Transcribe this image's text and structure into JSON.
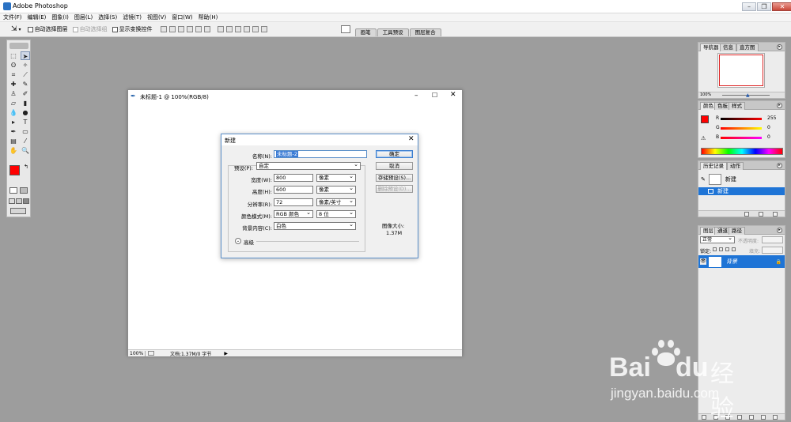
{
  "app": {
    "title": "Adobe Photoshop"
  },
  "window_controls": {
    "minimize": "–",
    "restore": "❐",
    "close": "✕"
  },
  "menu": [
    "文件(F)",
    "编辑(E)",
    "图象(I)",
    "图层(L)",
    "选择(S)",
    "滤镜(T)",
    "视图(V)",
    "窗口(W)",
    "帮助(H)"
  ],
  "options_bar": {
    "auto_select_layer": "自动选择图层",
    "auto_select_group": "自动选择组",
    "show_transform": "显示变换控件",
    "dock_tabs": [
      "画笔",
      "工具预设",
      "图层复合"
    ]
  },
  "document": {
    "title": "未标题-1 @ 100%(RGB/8)",
    "zoom": "100%",
    "doc_info": "文档:1.37M/0 字节"
  },
  "new_dialog": {
    "title": "新建",
    "name_label": "名称(N):",
    "name_value": "未标题-2",
    "preset_label": "预设(P):",
    "preset_value": "自定",
    "width_label": "宽度(W):",
    "width_value": "800",
    "width_unit": "像素",
    "height_label": "高度(H):",
    "height_value": "600",
    "height_unit": "像素",
    "resolution_label": "分辨率(R):",
    "resolution_value": "72",
    "resolution_unit": "像素/英寸",
    "color_mode_label": "颜色模式(M):",
    "color_mode_value": "RGB 颜色",
    "bit_depth_value": "8 位",
    "background_label": "背景内容(C):",
    "background_value": "白色",
    "advanced_label": "高级",
    "ok": "确定",
    "cancel": "取消",
    "save_preset": "存储预设(S)...",
    "delete_preset": "删除预设(D)...",
    "image_size_label": "图像大小:",
    "image_size_value": "1.37M"
  },
  "panels": {
    "navigator_tabs": [
      "导航器",
      "信息",
      "直方图"
    ],
    "navigator_zoom": "100%",
    "color_tabs": [
      "颜色",
      "色板",
      "样式"
    ],
    "color_r": "255",
    "color_g": "0",
    "color_b": "0",
    "history_tabs": [
      "历史记录",
      "动作"
    ],
    "history_items": [
      "新建",
      "新建"
    ],
    "layers_tabs": [
      "图层",
      "通道",
      "路径"
    ],
    "blend_mode": "正常",
    "opacity_label": "不透明度:",
    "lock_label": "锁定:",
    "fill_label": "填充:",
    "layer_name": "背景"
  },
  "watermark": {
    "brand": "Bai",
    "brand2": "du",
    "cn": "经验",
    "url": "jingyan.baidu.com"
  },
  "colors": {
    "foreground": "#ff0000",
    "selection": "#1e74d6",
    "dialog_border": "#5b8fc9",
    "canvas_bg": "#9d9d9d"
  }
}
